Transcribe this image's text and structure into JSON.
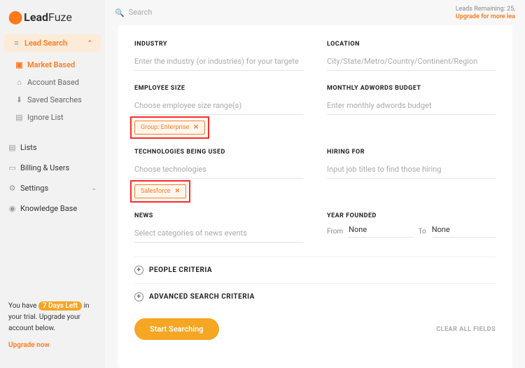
{
  "brand": {
    "lead": "Lead",
    "fuze": "Fuze"
  },
  "topbar": {
    "search_placeholder": "Search",
    "leads_remaining": "Leads Remaining: 25,",
    "upgrade_link": "Upgrade for more lea"
  },
  "sidebar": {
    "lead_search": "Lead Search",
    "items": [
      {
        "label": "Market Based"
      },
      {
        "label": "Account Based"
      },
      {
        "label": "Saved Searches"
      },
      {
        "label": "Ignore List"
      }
    ],
    "flat": [
      {
        "label": "Lists"
      },
      {
        "label": "Billing & Users"
      },
      {
        "label": "Settings"
      },
      {
        "label": "Knowledge Base"
      }
    ],
    "trial_prefix": "You have ",
    "trial_badge": "7 Days Left",
    "trial_suffix": " in your trial. Upgrade your account below.",
    "trial_upgrade": "Upgrade now"
  },
  "form": {
    "industry": {
      "label": "INDUSTRY",
      "placeholder": "Enter the industry (or industries) for your targete"
    },
    "location": {
      "label": "LOCATION",
      "placeholder": "City/State/Metro/Country/Continent/Region"
    },
    "employee": {
      "label": "EMPLOYEE SIZE",
      "placeholder": "Choose employee size range(s)",
      "tag": "Group: Enterprise"
    },
    "adwords": {
      "label": "MONTHLY ADWORDS BUDGET",
      "placeholder": "Enter monthly adwords budget"
    },
    "tech": {
      "label": "TECHNOLOGIES BEING USED",
      "placeholder": "Choose technologies",
      "tag": "Salesforce"
    },
    "hiring": {
      "label": "HIRING FOR",
      "placeholder": "Input job titles to find those hiring"
    },
    "news": {
      "label": "NEWS",
      "placeholder": "Select categories of news events"
    },
    "founded": {
      "label": "YEAR FOUNDED",
      "from": "From",
      "to": "To",
      "none": "None"
    },
    "people": "PEOPLE CRITERIA",
    "advanced": "ADVANCED SEARCH CRITERIA",
    "start": "Start Searching",
    "clear": "CLEAR ALL FIELDS"
  }
}
